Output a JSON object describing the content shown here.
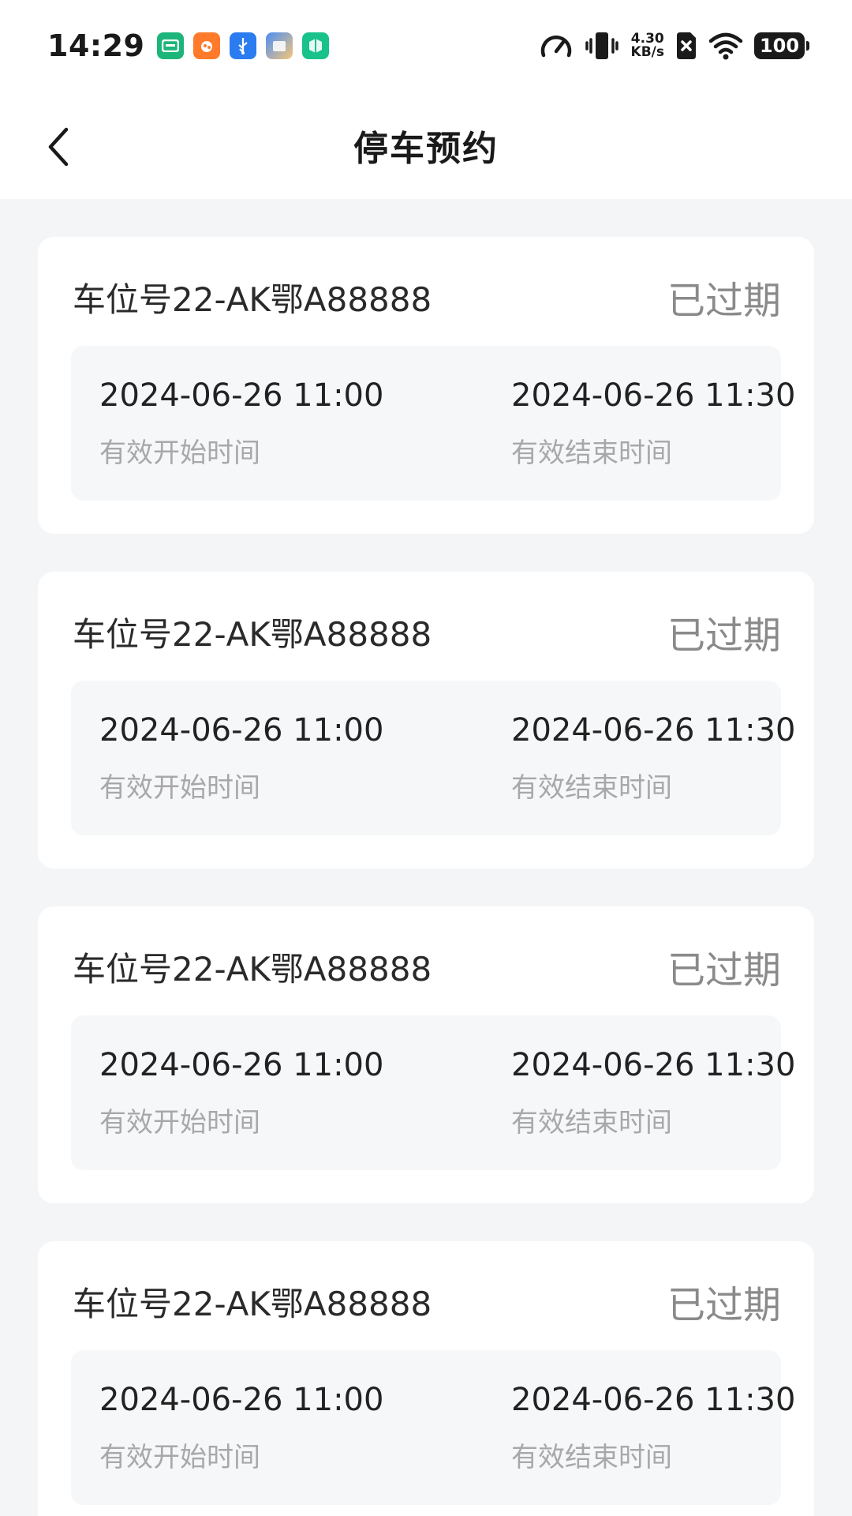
{
  "status_bar": {
    "time": "14:29",
    "net_speed_value": "4.30",
    "net_speed_unit": "KB/s",
    "battery": "100",
    "notification_icons": [
      {
        "name": "message-app-icon",
        "color": "#1db57a"
      },
      {
        "name": "orange-app-icon",
        "color": "#ff7a2a"
      },
      {
        "name": "usb-icon",
        "color": "#2a7cf0"
      },
      {
        "name": "files-app-icon",
        "color": "#4a8ef5"
      },
      {
        "name": "security-app-icon",
        "color": "#18c28a"
      }
    ]
  },
  "header": {
    "title": "停车预约"
  },
  "reservations": [
    {
      "spot": "车位号22-AK鄂A88888",
      "status": "已过期",
      "start_time": "2024-06-26 11:00",
      "start_label": "有效开始时间",
      "end_time": "2024-06-26 11:30",
      "end_label": "有效结束时间"
    },
    {
      "spot": "车位号22-AK鄂A88888",
      "status": "已过期",
      "start_time": "2024-06-26 11:00",
      "start_label": "有效开始时间",
      "end_time": "2024-06-26 11:30",
      "end_label": "有效结束时间"
    },
    {
      "spot": "车位号22-AK鄂A88888",
      "status": "已过期",
      "start_time": "2024-06-26 11:00",
      "start_label": "有效开始时间",
      "end_time": "2024-06-26 11:30",
      "end_label": "有效结束时间"
    },
    {
      "spot": "车位号22-AK鄂A88888",
      "status": "已过期",
      "start_time": "2024-06-26 11:00",
      "start_label": "有效开始时间",
      "end_time": "2024-06-26 11:30",
      "end_label": "有效结束时间"
    }
  ],
  "colors": {
    "background": "#f4f5f7",
    "card": "#ffffff",
    "time_box": "#f6f7f9",
    "status_text": "#8a8a8a",
    "label_text": "#a8a8a8"
  }
}
